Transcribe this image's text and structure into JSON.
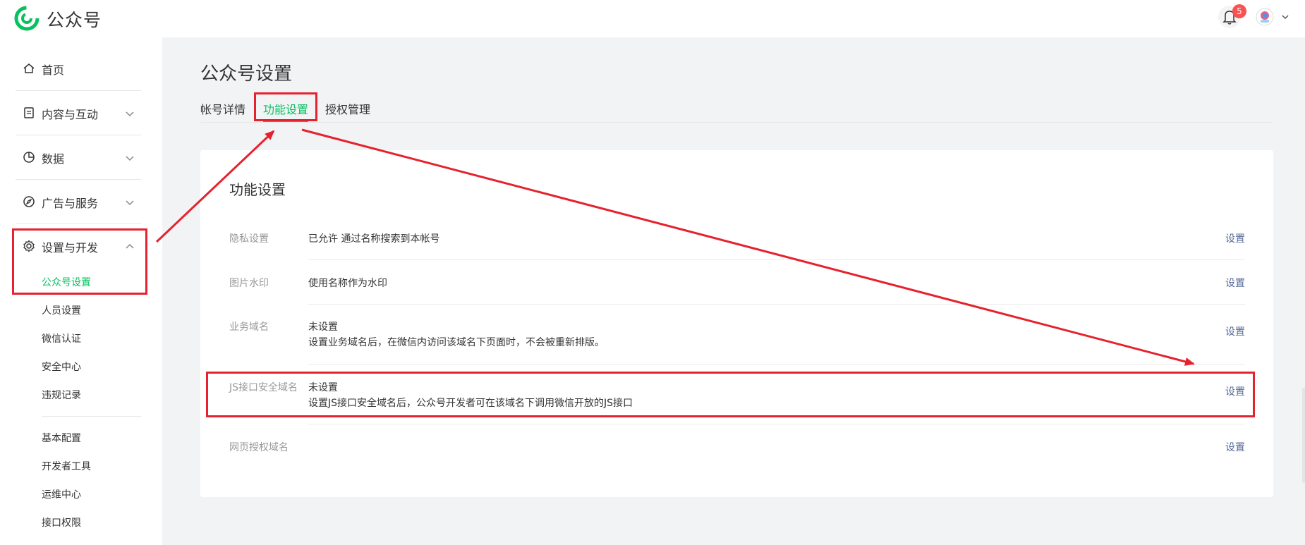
{
  "app": {
    "brand": "公众号",
    "notification_count": "5"
  },
  "sidebar": {
    "items": [
      {
        "label": "首页",
        "icon": "home-icon"
      },
      {
        "label": "内容与互动",
        "icon": "document-icon"
      },
      {
        "label": "数据",
        "icon": "pie-chart-icon"
      },
      {
        "label": "广告与服务",
        "icon": "compass-icon"
      },
      {
        "label": "设置与开发",
        "icon": "gear-icon"
      }
    ],
    "sub_items_group1": [
      "公众号设置",
      "人员设置",
      "微信认证",
      "安全中心",
      "违规记录"
    ],
    "sub_items_group2": [
      "基本配置",
      "开发者工具",
      "运维中心",
      "接口权限"
    ]
  },
  "page": {
    "title": "公众号设置",
    "tabs": [
      "帐号详情",
      "功能设置",
      "授权管理"
    ]
  },
  "card": {
    "title": "功能设置",
    "action_label": "设置",
    "rows": [
      {
        "label": "隐私设置",
        "value": "已允许 通过名称搜索到本帐号",
        "desc": ""
      },
      {
        "label": "图片水印",
        "value": "使用名称作为水印",
        "desc": ""
      },
      {
        "label": "业务域名",
        "value": "未设置",
        "desc": "设置业务域名后，在微信内访问该域名下页面时，不会被重新排版。"
      },
      {
        "label": "JS接口安全域名",
        "value": "未设置",
        "desc": "设置JS接口安全域名后，公众号开发者可在该域名下调用微信开放的JS接口"
      },
      {
        "label": "网页授权域名",
        "value": "",
        "desc": ""
      }
    ]
  },
  "colors": {
    "accent": "#07c160",
    "link": "#576b95",
    "annotation": "#e5222e",
    "badge": "#fa5151"
  }
}
